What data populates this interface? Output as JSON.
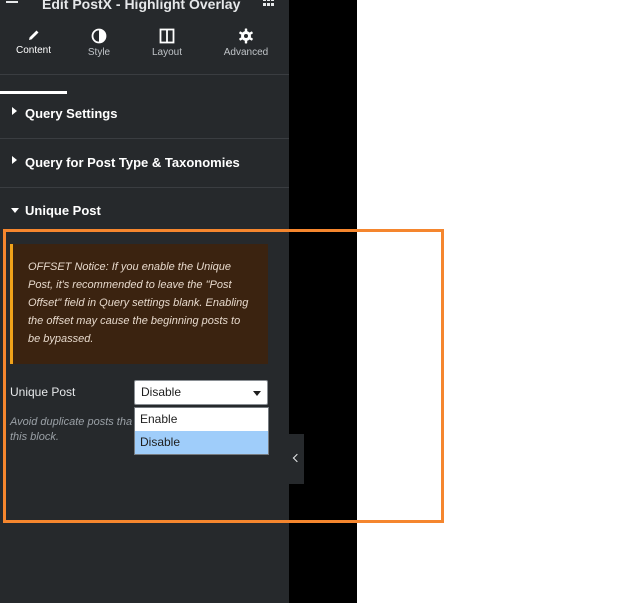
{
  "panel": {
    "title": "Edit PostX - Highlight Overlay",
    "tabs": [
      {
        "label": "Content",
        "icon": "pencil-icon",
        "active": true
      },
      {
        "label": "Style",
        "icon": "half-circle-icon",
        "active": false
      },
      {
        "label": "Layout",
        "icon": "columns-icon",
        "active": false
      },
      {
        "label": "Advanced",
        "icon": "gear-icon",
        "active": false
      }
    ]
  },
  "sections": {
    "query_settings": "Query Settings",
    "query_post_type": "Query for Post Type & Taxonomies",
    "unique_post": "Unique Post"
  },
  "notice": {
    "text": "OFFSET Notice: If you enable the Unique Post, it's recommended to leave the \"Post Offset\" field in Query settings blank. Enabling the offset may cause the beginning posts to be bypassed."
  },
  "unique_post_field": {
    "label": "Unique Post",
    "selected": "Disable",
    "help": "Avoid duplicate posts tha this block.",
    "options": [
      "Enable",
      "Disable"
    ]
  },
  "colors": {
    "panel_bg": "#26292c",
    "notice_bg": "#3b2310",
    "notice_accent": "#f0a21a",
    "highlight": "#f5862e",
    "option_selected": "#9fcdfa"
  }
}
